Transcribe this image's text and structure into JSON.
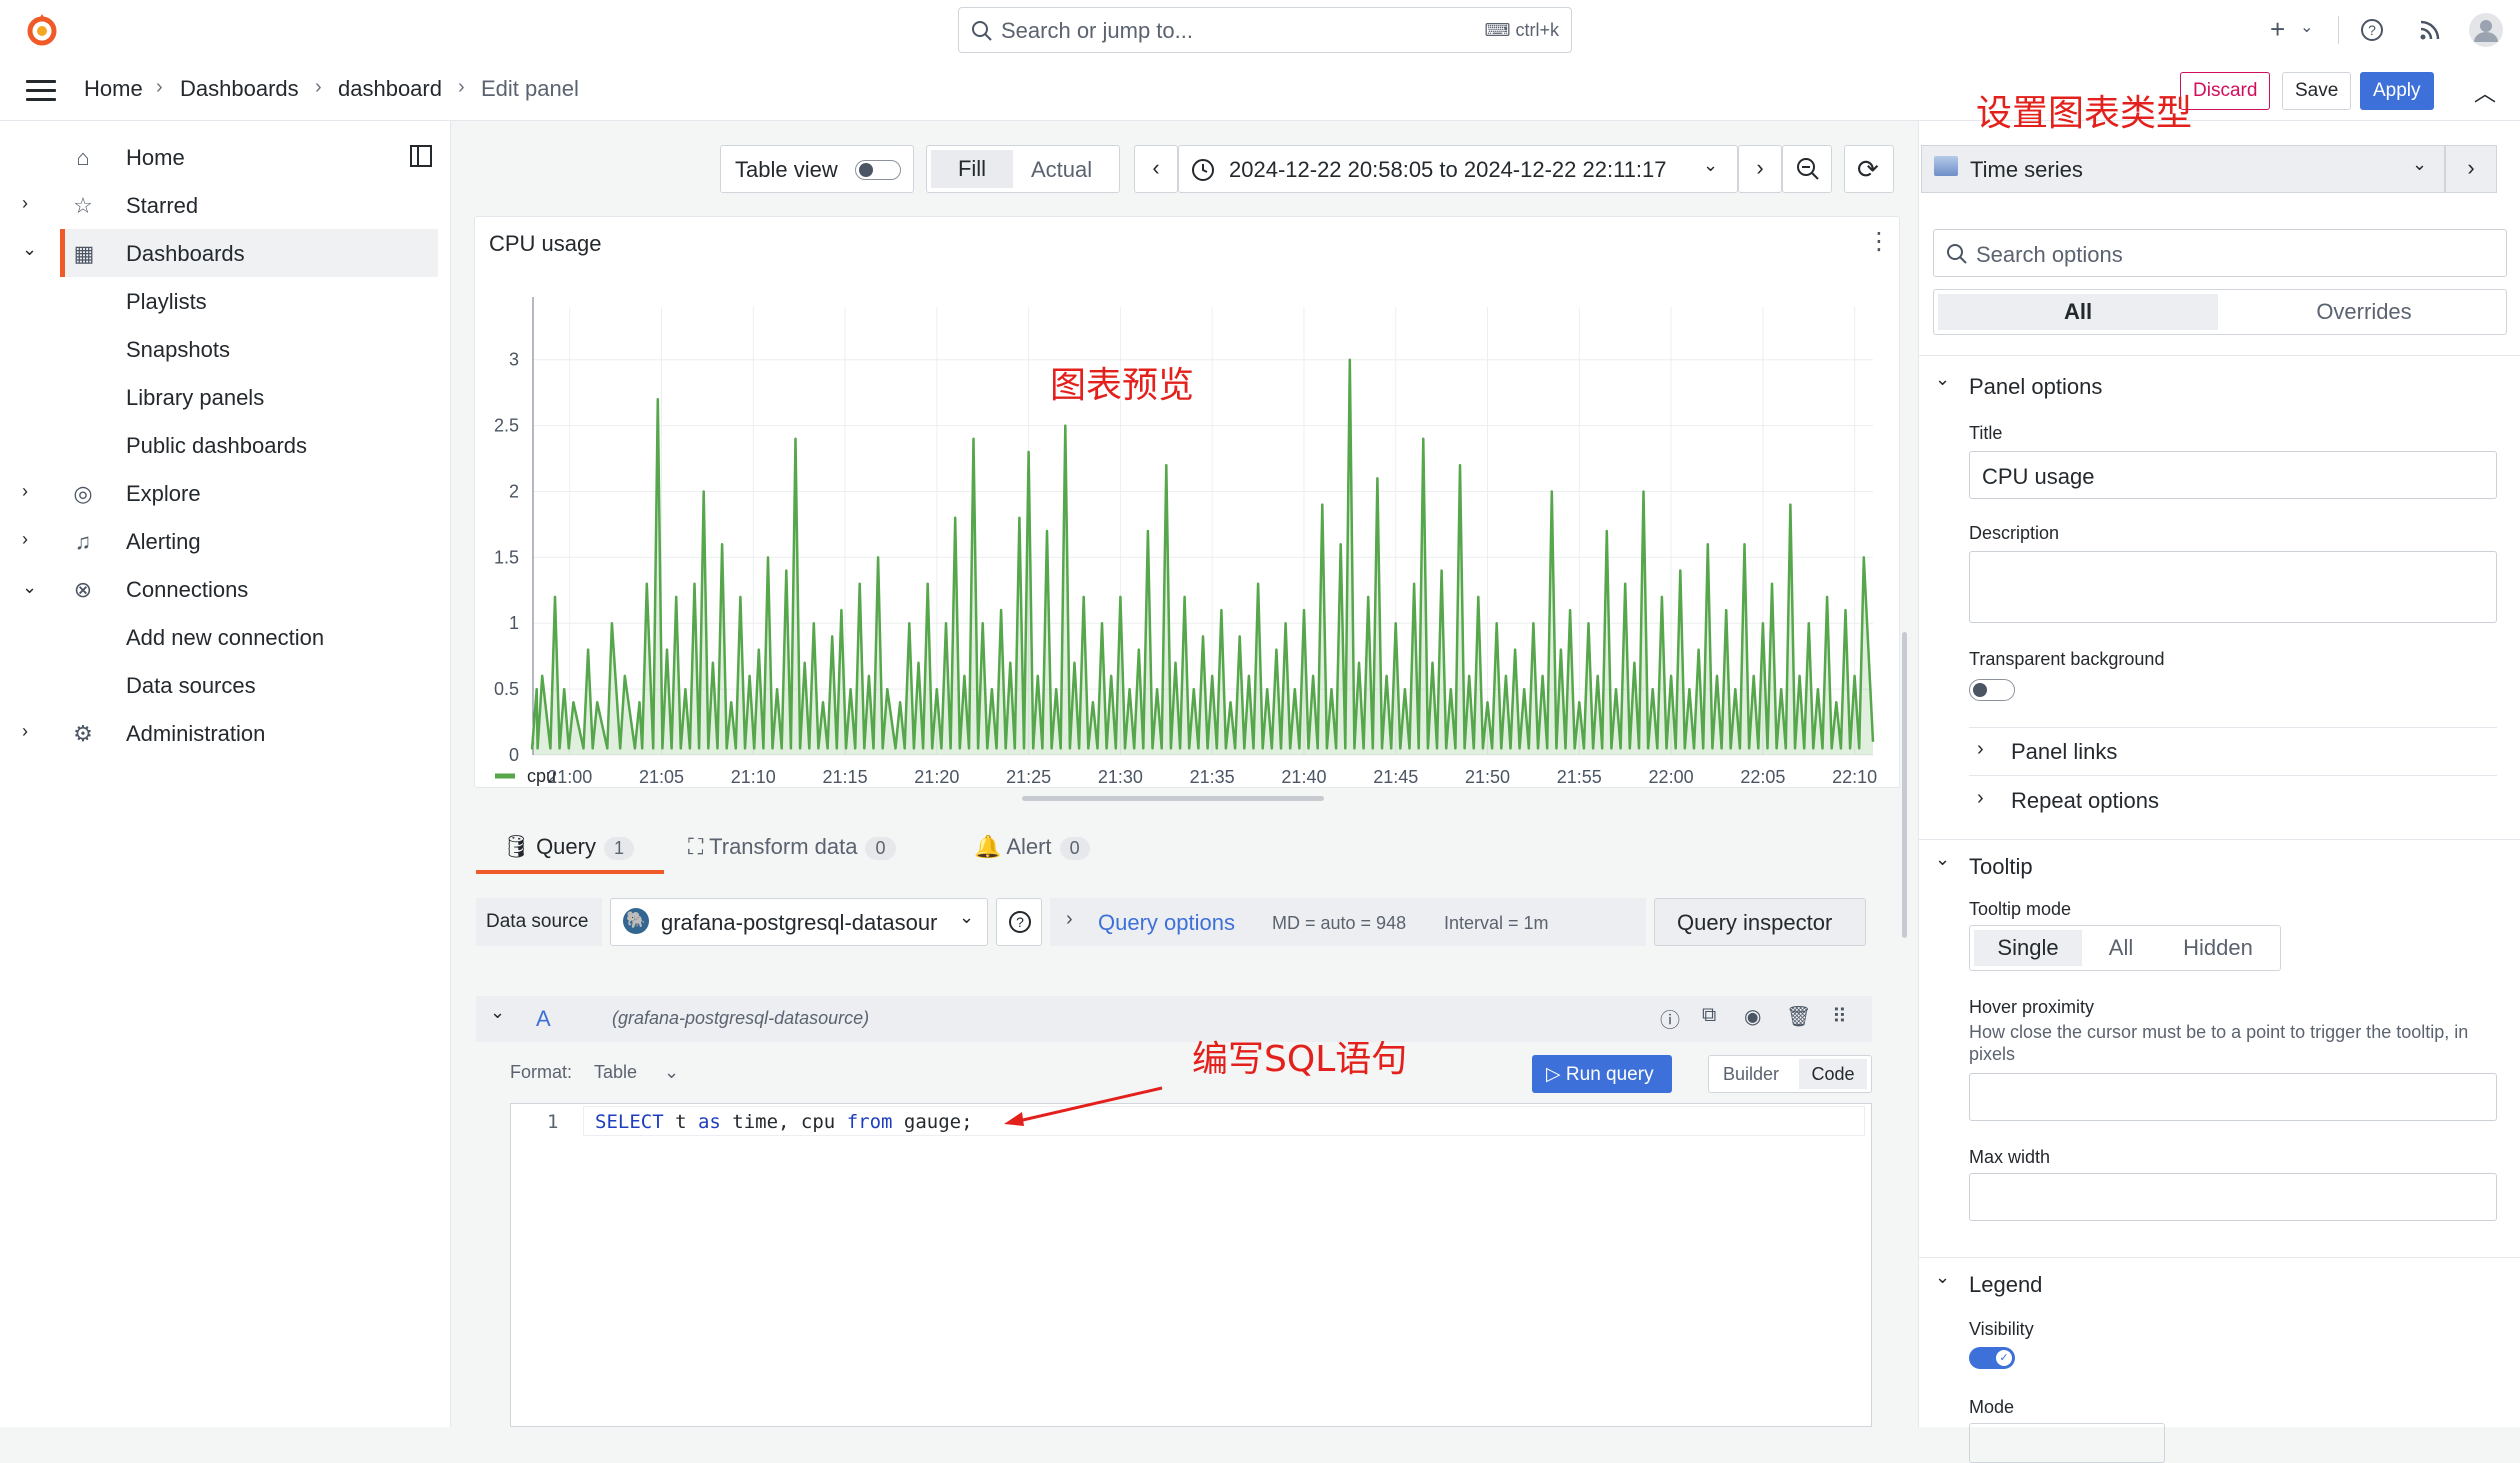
{
  "topbar": {
    "search_placeholder": "Search or jump to...",
    "search_shortcut": "ctrl+k"
  },
  "breadcrumbs": [
    "Home",
    "dashboard",
    "Edit panel"
  ],
  "breadcrumb_dashboards": "Dashboards",
  "header_buttons": {
    "discard": "Discard",
    "save": "Save",
    "apply": "Apply"
  },
  "sidebar": {
    "items": [
      {
        "label": "Home"
      },
      {
        "label": "Starred"
      },
      {
        "label": "Dashboards"
      },
      {
        "label": "Playlists"
      },
      {
        "label": "Snapshots"
      },
      {
        "label": "Library panels"
      },
      {
        "label": "Public dashboards"
      },
      {
        "label": "Explore"
      },
      {
        "label": "Alerting"
      },
      {
        "label": "Connections"
      },
      {
        "label": "Add new connection"
      },
      {
        "label": "Data sources"
      },
      {
        "label": "Administration"
      }
    ]
  },
  "panel_toolbar": {
    "table_view": "Table view",
    "fill": "Fill",
    "actual": "Actual",
    "time_range": "2024-12-22 20:58:05 to 2024-12-22 22:11:17"
  },
  "viz_picker": {
    "label": "Time series"
  },
  "panel": {
    "title": "CPU usage"
  },
  "chart_data": {
    "type": "area",
    "title": "CPU usage",
    "y_ticks": [
      "3",
      "2.5",
      "2",
      "1.5",
      "1",
      "0.5",
      "0"
    ],
    "x_ticks": [
      "21:00",
      "21:05",
      "21:10",
      "21:15",
      "21:20",
      "21:25",
      "21:30",
      "21:35",
      "21:40",
      "21:45",
      "21:50",
      "21:55",
      "22:00",
      "22:05",
      "22:10"
    ],
    "ylim": [
      0,
      3.4
    ],
    "grid": true,
    "legend": "bottom-left",
    "series": [
      {
        "name": "cpu",
        "color": "#56a64b",
        "peaks": [
          [
            0.2,
            0.5
          ],
          [
            0.5,
            0.6
          ],
          [
            1.2,
            1.2
          ],
          [
            1.7,
            0.5
          ],
          [
            2.2,
            0.4
          ],
          [
            3.0,
            0.8
          ],
          [
            3.5,
            0.4
          ],
          [
            4.3,
            1.0
          ],
          [
            5.0,
            0.6
          ],
          [
            5.8,
            0.4
          ],
          [
            6.2,
            1.3
          ],
          [
            6.8,
            2.7
          ],
          [
            7.3,
            0.8
          ],
          [
            7.8,
            1.2
          ],
          [
            8.3,
            0.5
          ],
          [
            8.8,
            1.3
          ],
          [
            9.3,
            2.0
          ],
          [
            9.8,
            0.7
          ],
          [
            10.3,
            1.6
          ],
          [
            10.8,
            0.4
          ],
          [
            11.3,
            1.2
          ],
          [
            11.8,
            0.6
          ],
          [
            12.3,
            0.8
          ],
          [
            12.8,
            1.5
          ],
          [
            13.3,
            0.5
          ],
          [
            13.8,
            1.4
          ],
          [
            14.3,
            2.4
          ],
          [
            14.8,
            0.7
          ],
          [
            15.3,
            1.0
          ],
          [
            15.8,
            0.4
          ],
          [
            16.3,
            0.9
          ],
          [
            16.8,
            1.1
          ],
          [
            17.3,
            0.5
          ],
          [
            17.8,
            1.3
          ],
          [
            18.3,
            0.6
          ],
          [
            18.8,
            1.5
          ],
          [
            19.3,
            0.5
          ],
          [
            20.0,
            0.4
          ],
          [
            20.5,
            1.0
          ],
          [
            21.0,
            0.7
          ],
          [
            21.5,
            1.3
          ],
          [
            22.0,
            0.5
          ],
          [
            22.5,
            1.0
          ],
          [
            23.0,
            1.8
          ],
          [
            23.5,
            0.6
          ],
          [
            24.0,
            2.4
          ],
          [
            24.5,
            1.0
          ],
          [
            25.0,
            0.5
          ],
          [
            25.5,
            1.1
          ],
          [
            26.0,
            0.7
          ],
          [
            26.5,
            1.8
          ],
          [
            27.0,
            2.3
          ],
          [
            27.5,
            0.6
          ],
          [
            28.0,
            1.7
          ],
          [
            28.5,
            0.5
          ],
          [
            29.0,
            2.5
          ],
          [
            29.5,
            0.7
          ],
          [
            30.0,
            1.2
          ],
          [
            30.5,
            0.4
          ],
          [
            31.0,
            1.0
          ],
          [
            31.5,
            0.6
          ],
          [
            32.0,
            1.2
          ],
          [
            32.5,
            0.5
          ],
          [
            33.0,
            0.8
          ],
          [
            33.5,
            1.7
          ],
          [
            34.0,
            0.5
          ],
          [
            34.5,
            2.2
          ],
          [
            35.0,
            0.7
          ],
          [
            35.5,
            1.2
          ],
          [
            36.0,
            0.5
          ],
          [
            36.5,
            0.9
          ],
          [
            37.0,
            0.6
          ],
          [
            37.5,
            1.1
          ],
          [
            38.0,
            0.4
          ],
          [
            38.5,
            0.9
          ],
          [
            39.0,
            0.6
          ],
          [
            39.5,
            1.3
          ],
          [
            40.0,
            0.5
          ],
          [
            40.5,
            0.8
          ],
          [
            41.0,
            1.0
          ],
          [
            41.5,
            0.5
          ],
          [
            42.0,
            1.1
          ],
          [
            42.5,
            0.6
          ],
          [
            43.0,
            1.9
          ],
          [
            43.5,
            0.5
          ],
          [
            44.0,
            1.6
          ],
          [
            44.5,
            3.0
          ],
          [
            45.0,
            0.7
          ],
          [
            45.5,
            1.2
          ],
          [
            46.0,
            2.1
          ],
          [
            46.5,
            0.6
          ],
          [
            47.0,
            1.0
          ],
          [
            47.5,
            0.5
          ],
          [
            48.0,
            1.3
          ],
          [
            48.5,
            2.4
          ],
          [
            49.0,
            0.7
          ],
          [
            49.5,
            1.4
          ],
          [
            50.0,
            0.5
          ],
          [
            50.5,
            2.2
          ],
          [
            51.0,
            0.6
          ],
          [
            51.5,
            1.2
          ],
          [
            52.0,
            0.4
          ],
          [
            52.5,
            1.0
          ],
          [
            53.0,
            0.6
          ],
          [
            53.5,
            0.8
          ],
          [
            54.0,
            0.5
          ],
          [
            54.5,
            1.0
          ],
          [
            55.0,
            0.6
          ],
          [
            55.5,
            2.0
          ],
          [
            56.0,
            0.8
          ],
          [
            56.5,
            1.1
          ],
          [
            57.0,
            0.4
          ],
          [
            57.5,
            1.0
          ],
          [
            58.0,
            0.6
          ],
          [
            58.5,
            1.7
          ],
          [
            59.0,
            0.5
          ],
          [
            59.5,
            1.3
          ],
          [
            60.0,
            0.7
          ],
          [
            60.5,
            2.0
          ],
          [
            61.0,
            0.5
          ],
          [
            61.5,
            1.2
          ],
          [
            62.0,
            0.6
          ],
          [
            62.5,
            1.4
          ],
          [
            63.0,
            0.5
          ],
          [
            63.5,
            0.8
          ],
          [
            64.0,
            1.6
          ],
          [
            64.5,
            0.6
          ],
          [
            65.0,
            1.1
          ],
          [
            65.5,
            0.5
          ],
          [
            66.0,
            1.6
          ],
          [
            66.5,
            0.6
          ],
          [
            67.0,
            1.0
          ],
          [
            67.5,
            1.3
          ],
          [
            68.0,
            0.5
          ],
          [
            68.5,
            1.9
          ],
          [
            69.0,
            0.6
          ],
          [
            69.5,
            1.0
          ],
          [
            70.0,
            0.5
          ],
          [
            70.5,
            1.2
          ],
          [
            71.0,
            0.4
          ],
          [
            71.5,
            1.1
          ],
          [
            72.0,
            0.6
          ],
          [
            72.5,
            1.5
          ]
        ]
      }
    ]
  },
  "query_tabs": [
    {
      "label": "Query",
      "count": "1"
    },
    {
      "label": "Transform data",
      "count": "0"
    },
    {
      "label": "Alert",
      "count": "0"
    }
  ],
  "query_bar": {
    "data_source_label": "Data source",
    "data_source": "grafana-postgresql-datasour",
    "query_options": "Query options",
    "md": "MD = auto = 948",
    "interval": "Interval = 1m",
    "inspector": "Query inspector"
  },
  "query_row": {
    "ref": "A",
    "ds": "(grafana-postgresql-datasource)",
    "format_label": "Format:",
    "format_value": "Table",
    "run": "Run query",
    "builder": "Builder",
    "code": "Code"
  },
  "sql": {
    "line_no": "1",
    "tokens": [
      {
        "t": "SELECT",
        "kw": true
      },
      {
        "t": " t ",
        "kw": false
      },
      {
        "t": "as",
        "kw": true
      },
      {
        "t": " time, cpu ",
        "kw": false
      },
      {
        "t": "from",
        "kw": true
      },
      {
        "t": " gauge;",
        "kw": false
      }
    ]
  },
  "options": {
    "search_placeholder": "Search options",
    "tab_all": "All",
    "tab_overrides": "Overrides",
    "panel_options": "Panel options",
    "title_label": "Title",
    "title_value": "CPU usage",
    "description_label": "Description",
    "transparent_label": "Transparent background",
    "panel_links": "Panel links",
    "repeat_options": "Repeat options",
    "tooltip": "Tooltip",
    "tooltip_mode": "Tooltip mode",
    "mode_single": "Single",
    "mode_all": "All",
    "mode_hidden": "Hidden",
    "hover_proximity": "Hover proximity",
    "hover_desc": "How close the cursor must be to a point to trigger the tooltip, in pixels",
    "max_width": "Max width",
    "legend": "Legend",
    "visibility": "Visibility",
    "mode": "Mode"
  },
  "annotations": {
    "chart_type": "设置图表类型",
    "preview": "图表预览",
    "sql": "编写SQL语句"
  },
  "colors": {
    "accent": "#3d71d9",
    "series": "#56a64b",
    "annotation": "#e3201b",
    "brand": "#f05a28"
  }
}
